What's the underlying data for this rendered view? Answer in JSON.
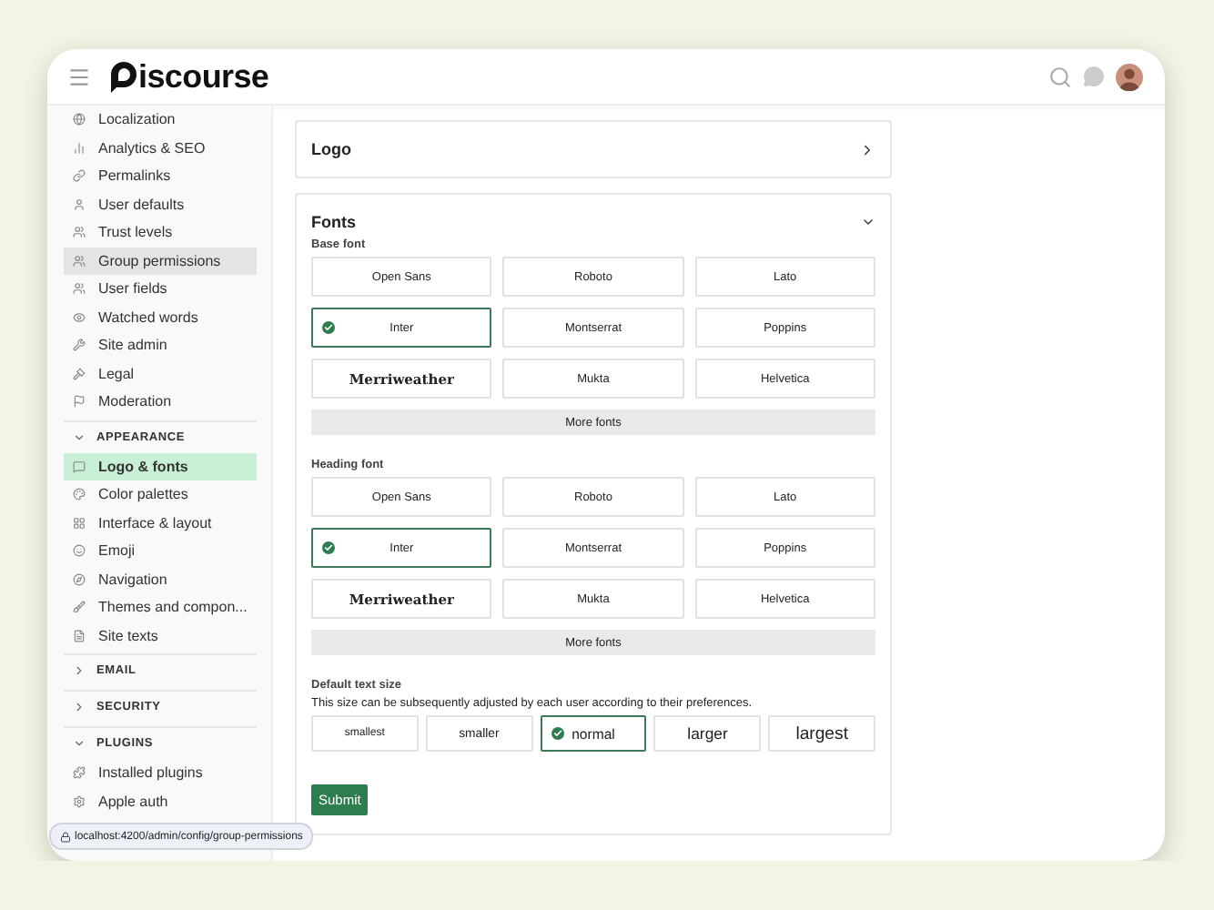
{
  "header": {
    "logo_text": "iscourse"
  },
  "sidebar": {
    "items": [
      {
        "label": "Localization",
        "selected": false,
        "hovered": false
      },
      {
        "label": "Analytics & SEO",
        "selected": false,
        "hovered": false
      },
      {
        "label": "Permalinks",
        "selected": false,
        "hovered": false
      },
      {
        "label": "User defaults",
        "selected": false,
        "hovered": false
      },
      {
        "label": "Trust levels",
        "selected": false,
        "hovered": false
      },
      {
        "label": "Group permissions",
        "selected": false,
        "hovered": true
      },
      {
        "label": "User fields",
        "selected": false,
        "hovered": false
      },
      {
        "label": "Watched words",
        "selected": false,
        "hovered": false
      },
      {
        "label": "Site admin",
        "selected": false,
        "hovered": false
      },
      {
        "label": "Legal",
        "selected": false,
        "hovered": false
      },
      {
        "label": "Moderation",
        "selected": false,
        "hovered": false
      }
    ],
    "sections": [
      {
        "title": "APPEARANCE",
        "expanded": true,
        "items": [
          {
            "label": "Logo & fonts",
            "selected": true,
            "hovered": false
          },
          {
            "label": "Color palettes",
            "selected": false,
            "hovered": false
          },
          {
            "label": "Interface & layout",
            "selected": false,
            "hovered": false
          },
          {
            "label": "Emoji",
            "selected": false,
            "hovered": false
          },
          {
            "label": "Navigation",
            "selected": false,
            "hovered": false
          },
          {
            "label": "Themes and compon...",
            "selected": false,
            "hovered": false
          },
          {
            "label": "Site texts",
            "selected": false,
            "hovered": false
          }
        ]
      },
      {
        "title": "EMAIL",
        "expanded": false
      },
      {
        "title": "SECURITY",
        "expanded": false
      },
      {
        "title": "PLUGINS",
        "expanded": true,
        "items": [
          {
            "label": "Installed plugins",
            "selected": false,
            "hovered": false
          },
          {
            "label": "Apple auth",
            "selected": false,
            "hovered": false
          }
        ]
      }
    ]
  },
  "logo_panel": {
    "title": "Logo",
    "expanded": false
  },
  "fonts_panel": {
    "title": "Fonts",
    "expanded": true,
    "groups": [
      {
        "label": "Base font",
        "more": "More fonts",
        "fonts": [
          {
            "name": "Open Sans",
            "kind": "sans",
            "selected": false
          },
          {
            "name": "Roboto",
            "kind": "sans",
            "selected": false
          },
          {
            "name": "Lato",
            "kind": "sans",
            "selected": false
          },
          {
            "name": "Inter",
            "kind": "sans",
            "selected": true
          },
          {
            "name": "Montserrat",
            "kind": "sans",
            "selected": false
          },
          {
            "name": "Poppins",
            "kind": "sans",
            "selected": false
          },
          {
            "name": "Merriweather",
            "kind": "serif",
            "selected": false
          },
          {
            "name": "Mukta",
            "kind": "sans",
            "selected": false
          },
          {
            "name": "Helvetica",
            "kind": "sans",
            "selected": false
          }
        ]
      },
      {
        "label": "Heading font",
        "more": "More fonts",
        "fonts": [
          {
            "name": "Open Sans",
            "kind": "sans",
            "selected": false
          },
          {
            "name": "Roboto",
            "kind": "sans",
            "selected": false
          },
          {
            "name": "Lato",
            "kind": "sans",
            "selected": false
          },
          {
            "name": "Inter",
            "kind": "sans",
            "selected": true
          },
          {
            "name": "Montserrat",
            "kind": "sans",
            "selected": false
          },
          {
            "name": "Poppins",
            "kind": "sans",
            "selected": false
          },
          {
            "name": "Merriweather",
            "kind": "serif",
            "selected": false
          },
          {
            "name": "Mukta",
            "kind": "sans",
            "selected": false
          },
          {
            "name": "Helvetica",
            "kind": "sans",
            "selected": false
          }
        ]
      }
    ],
    "text_size": {
      "label": "Default text size",
      "description": "This size can be subsequently adjusted by each user according to their preferences.",
      "options": [
        {
          "label": "smallest",
          "selected": false
        },
        {
          "label": "smaller",
          "selected": false
        },
        {
          "label": "normal",
          "selected": true
        },
        {
          "label": "larger",
          "selected": false
        },
        {
          "label": "largest",
          "selected": false
        }
      ]
    },
    "submit": "Submit"
  },
  "status_url": "localhost:4200/admin/config/group-permissions"
}
